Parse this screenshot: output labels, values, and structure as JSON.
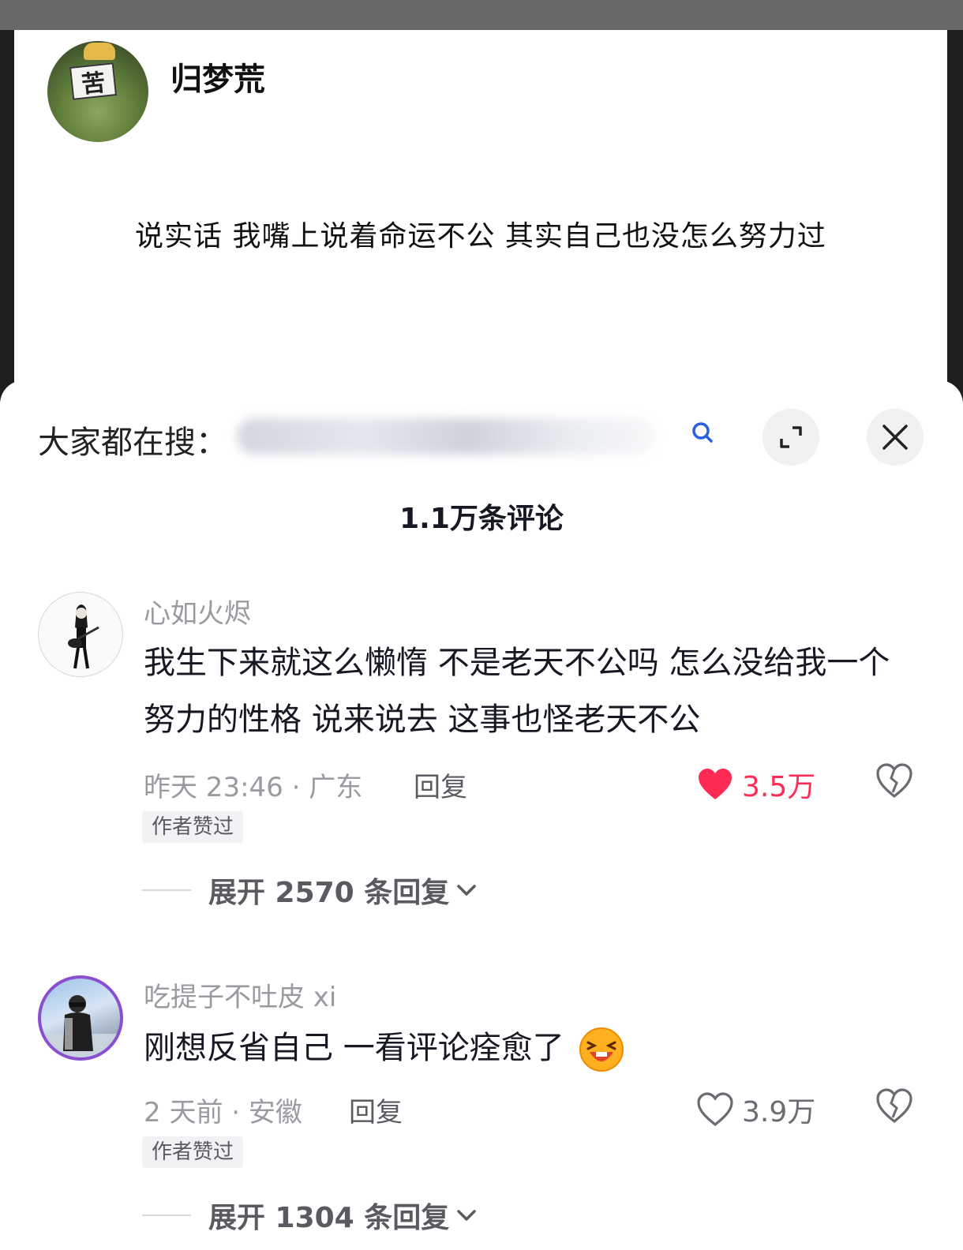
{
  "post": {
    "author": "归梦荒",
    "avatar_sign": "苦",
    "text": "说实话  我嘴上说着命运不公  其实自己也没怎么努力过"
  },
  "sheet": {
    "search_label": "大家都在搜：",
    "comment_count": "1.1万条评论"
  },
  "icons": {
    "search": "search-icon",
    "expand": "expand-icon",
    "close": "close-icon",
    "like": "heart-icon",
    "dislike": "broken-heart-icon"
  },
  "colors": {
    "accent": "#fe2c55",
    "muted": "#9a9ba1"
  },
  "comments": [
    {
      "username": "心如火烬",
      "content": "我生下来就这么懒惰 不是老天不公吗 怎么没给我一个努力的性格 说来说去 这事也怪老天不公",
      "time_location": "昨天 23:46 · 广东",
      "reply_label": "回复",
      "likes": "3.5万",
      "liked": true,
      "badge": "作者赞过",
      "expand_label": "展开 2570 条回复"
    },
    {
      "username": "吃提子不吐皮 xi",
      "content": "刚想反省自己 一看评论痊愈了",
      "emoji": "laughing-emoji",
      "time_location": "2 天前 · 安徽",
      "reply_label": "回复",
      "likes": "3.9万",
      "liked": false,
      "badge": "作者赞过",
      "expand_label": "展开 1304 条回复"
    }
  ]
}
